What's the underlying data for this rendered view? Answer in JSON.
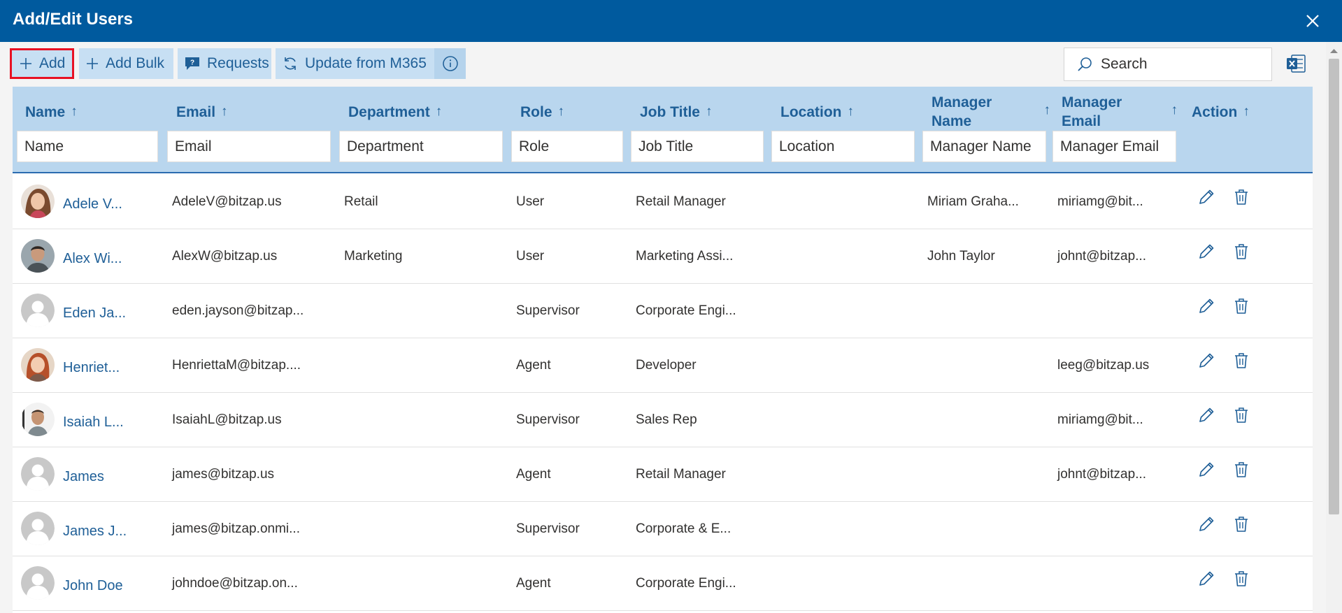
{
  "window": {
    "title": "Add/Edit Users"
  },
  "toolbar": {
    "add_label": "Add",
    "add_bulk_label": "Add Bulk",
    "requests_label": "Requests",
    "update_label": "Update from M365"
  },
  "search": {
    "placeholder": "Search"
  },
  "columns": [
    {
      "label": "Name",
      "filter_placeholder": "Name"
    },
    {
      "label": "Email",
      "filter_placeholder": "Email"
    },
    {
      "label": "Department",
      "filter_placeholder": "Department"
    },
    {
      "label": "Role",
      "filter_placeholder": "Role"
    },
    {
      "label": "Job Title",
      "filter_placeholder": "Job Title"
    },
    {
      "label": "Location",
      "filter_placeholder": "Location"
    },
    {
      "label": "Manager Name",
      "filter_placeholder": "Manager Name"
    },
    {
      "label": "Manager Email",
      "filter_placeholder": "Manager Email"
    },
    {
      "label": "Action"
    }
  ],
  "sort_arrow": "↑",
  "rows": [
    {
      "name": "Adele V...",
      "email": "AdeleV@bitzap.us",
      "department": "Retail",
      "role": "User",
      "job_title": "Retail Manager",
      "location": "",
      "manager_name": "Miriam Graha...",
      "manager_email": "miriamg@bit...",
      "avatar": "photo-woman-brown-hair"
    },
    {
      "name": "Alex Wi...",
      "email": "AlexW@bitzap.us",
      "department": "Marketing",
      "role": "User",
      "job_title": "Marketing Assi...",
      "location": "",
      "manager_name": "John Taylor",
      "manager_email": "johnt@bitzap...",
      "avatar": "photo-man-dark-hair"
    },
    {
      "name": "Eden Ja...",
      "email": "eden.jayson@bitzap...",
      "department": "",
      "role": "Supervisor",
      "job_title": "Corporate Engi...",
      "location": "",
      "manager_name": "",
      "manager_email": "",
      "avatar": "default-person"
    },
    {
      "name": "Henriet...",
      "email": "HenriettaM@bitzap....",
      "department": "",
      "role": "Agent",
      "job_title": "Developer",
      "location": "",
      "manager_name": "",
      "manager_email": "leeg@bitzap.us",
      "avatar": "photo-woman-red-hair"
    },
    {
      "name": "Isaiah L...",
      "email": "IsaiahL@bitzap.us",
      "department": "",
      "role": "Supervisor",
      "job_title": "Sales Rep",
      "location": "",
      "manager_name": "",
      "manager_email": "miriamg@bit...",
      "avatar": "photo-man-grey-shirt"
    },
    {
      "name": "James",
      "email": "james@bitzap.us",
      "department": "",
      "role": "Agent",
      "job_title": "Retail Manager",
      "location": "",
      "manager_name": "",
      "manager_email": "johnt@bitzap...",
      "avatar": "default-person"
    },
    {
      "name": "James J...",
      "email": "james@bitzap.onmi...",
      "department": "",
      "role": "Supervisor",
      "job_title": "Corporate & E...",
      "location": "",
      "manager_name": "",
      "manager_email": "",
      "avatar": "default-person"
    },
    {
      "name": "John Doe",
      "email": "johndoe@bitzap.on...",
      "department": "",
      "role": "Agent",
      "job_title": "Corporate Engi...",
      "location": "",
      "manager_name": "",
      "manager_email": "",
      "avatar": "default-person"
    }
  ],
  "colors": {
    "title_bar": "#005a9e",
    "toolbar_button_bg": "#c7dff3",
    "accent_text": "#1f5f97",
    "header_bg": "#b9d6ee",
    "highlight_border": "#e81123"
  }
}
